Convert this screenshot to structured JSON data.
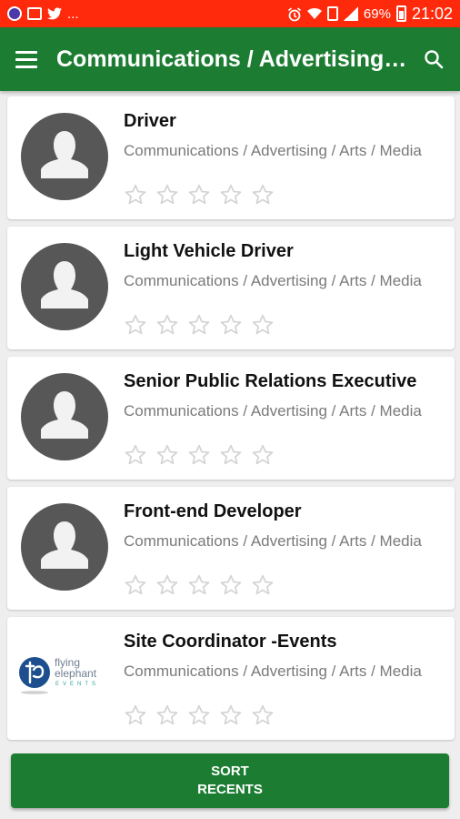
{
  "status_bar": {
    "left_icons": [
      "app-icon",
      "image-icon",
      "twitter-icon"
    ],
    "more_text": "...",
    "right_icons": [
      "alarm-icon",
      "wifi-icon",
      "data-icon",
      "signal-icon"
    ],
    "battery": "69%",
    "time": "21:02"
  },
  "app_bar": {
    "menu_icon": "hamburger-menu-icon",
    "title": "Communications / Advertising / Arts / Media",
    "search_icon": "search-icon"
  },
  "jobs": [
    {
      "title": "Driver",
      "category": "Communications / Advertising / Arts / Media",
      "rating": 0,
      "image": "avatar-placeholder"
    },
    {
      "title": "Light Vehicle Driver",
      "category": "Communications / Advertising / Arts / Media",
      "rating": 0,
      "image": "avatar-placeholder"
    },
    {
      "title": "Senior Public Relations Executive",
      "category": "Communications / Advertising / Arts / Media",
      "rating": 0,
      "image": "avatar-placeholder"
    },
    {
      "title": "Front-end Developer",
      "category": "Communications / Advertising / Arts / Media",
      "rating": 0,
      "image": "avatar-placeholder"
    },
    {
      "title": "Site Coordinator -Events",
      "category": "Communications / Advertising / Arts / Media",
      "rating": 0,
      "image": "flying-elephant-events-logo"
    }
  ],
  "logo": {
    "line1": "flying",
    "line2": "elephant",
    "line3": "EVENTS"
  },
  "sort_button": {
    "line1": "SORT",
    "line2": "RECENTS"
  },
  "colors": {
    "status_bar": "#ff2a0c",
    "primary": "#1c7d32",
    "avatar_bg": "#575757",
    "star": "#d4d4d4"
  }
}
